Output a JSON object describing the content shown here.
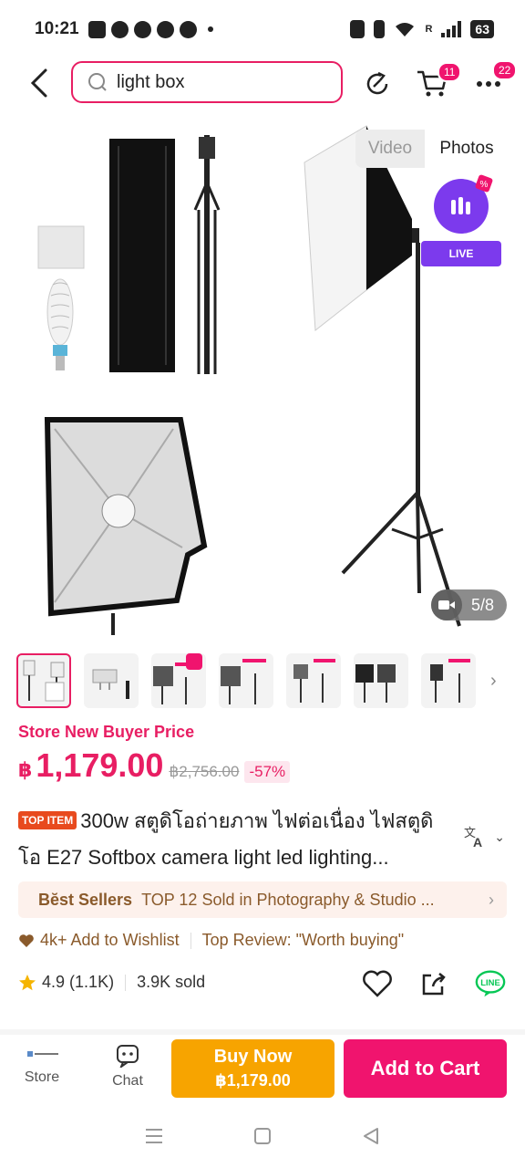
{
  "status": {
    "time": "10:21",
    "network": "R",
    "battery": "63"
  },
  "search": {
    "value": "light box"
  },
  "topbar": {
    "cart_badge": "11",
    "more_badge": "22"
  },
  "media": {
    "toggle_video": "Video",
    "toggle_photos": "Photos",
    "live_label": "LIVE",
    "counter": "5/8"
  },
  "price": {
    "buyer_label": "Store New Buyer Price",
    "currency": "฿",
    "current": "1,179.00",
    "original": "฿2,756.00",
    "discount": "-57%"
  },
  "product": {
    "tag": "TOP ITEM",
    "title": "300w สตูดิโอถ่ายภาพ ไฟต่อเนื่อง ไฟสตูดิโอ E27 Softbox camera light led lighting..."
  },
  "best_sellers": {
    "label": "Bĕst Sellers",
    "text": "TOP 12 Sold in Photography & Studio ..."
  },
  "wishlist": {
    "text": "4k+ Add to Wishlist",
    "review": "Top Review: \"Worth buying\""
  },
  "rating": {
    "score": "4.9",
    "count": "(1.1K)",
    "sold": "3.9K sold"
  },
  "actions": {
    "store": "Store",
    "chat": "Chat",
    "buy_now": "Buy Now",
    "buy_price": "฿1,179.00",
    "add_to_cart": "Add to Cart"
  },
  "colors": {
    "brand": "#f0146e",
    "buy": "#f7a400",
    "live": "#7c3aed"
  }
}
